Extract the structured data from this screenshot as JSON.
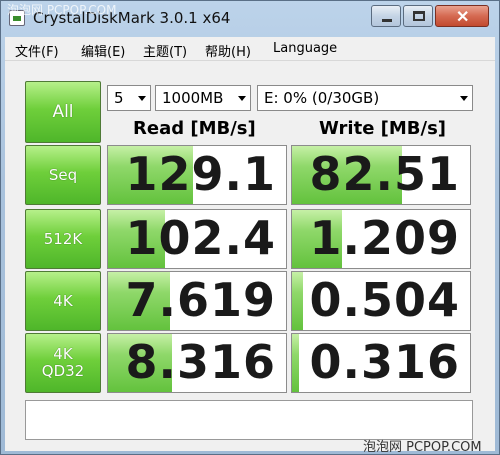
{
  "window": {
    "title": "CrystalDiskMark 3.0.1 x64",
    "watermark_top": "泡泡网 PCPOP.COM",
    "watermark_bottom": "泡泡网 PCPOP.COM",
    "buttons": {
      "minimize": "minimize-icon",
      "maximize": "maximize-icon",
      "close": "✕"
    }
  },
  "menu": [
    "文件(F)",
    "编辑(E)",
    "主题(T)",
    "帮助(H)",
    "Language"
  ],
  "controls": {
    "all_label": "All",
    "count": "5",
    "size": "1000MB",
    "drive": "E: 0% (0/30GB)"
  },
  "headers": {
    "read": "Read [MB/s]",
    "write": "Write [MB/s]"
  },
  "tests": [
    {
      "label": "Seq",
      "read": "129.1",
      "write": "82.51",
      "read_fill": 0.48,
      "write_fill": 0.62
    },
    {
      "label": "512K",
      "read": "102.4",
      "write": "1.209",
      "read_fill": 0.32,
      "write_fill": 0.28
    },
    {
      "label": "4K",
      "read": "7.619",
      "write": "0.504",
      "read_fill": 0.35,
      "write_fill": 0.06
    },
    {
      "label": "4K\nQD32",
      "read": "8.316",
      "write": "0.316",
      "read_fill": 0.36,
      "write_fill": 0.04
    }
  ],
  "colors": {
    "accent": "#5ec235",
    "bar": "#8fd86a"
  }
}
